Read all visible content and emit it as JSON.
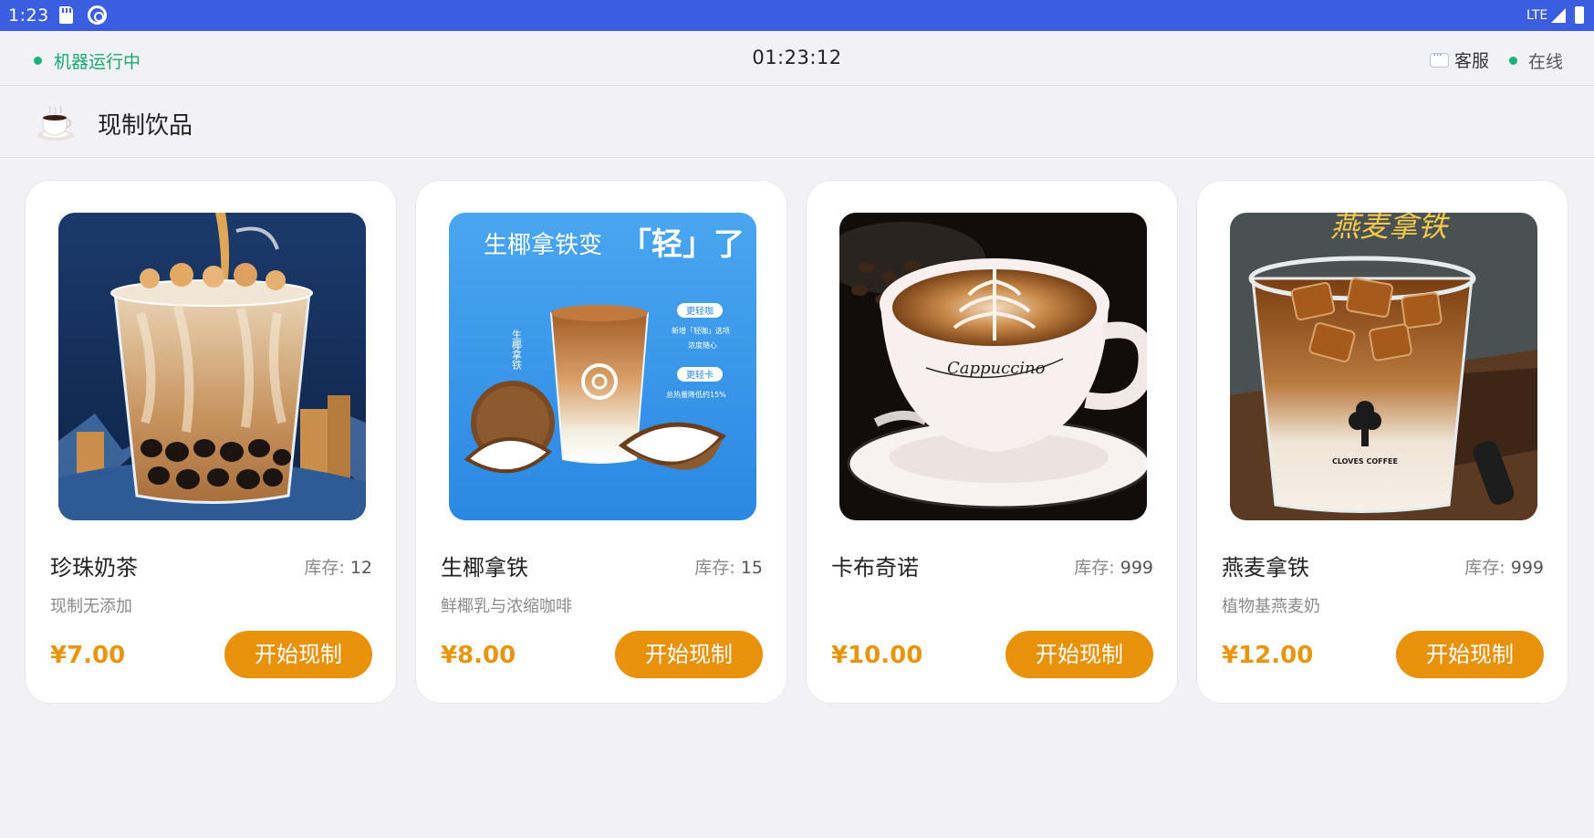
{
  "status_bar": {
    "time": "1:23",
    "network": "LTE"
  },
  "topbar": {
    "machine_status": "机器运行中",
    "clock": "01:23:12",
    "service_label": "客服",
    "online_label": "在线"
  },
  "category": {
    "title": "现制饮品"
  },
  "products": [
    {
      "name": "珍珠奶茶",
      "stock_label": "库存:",
      "stock": "12",
      "desc": "现制无添加",
      "price": "¥7.00",
      "button": "开始现制"
    },
    {
      "name": "生椰拿铁",
      "stock_label": "库存:",
      "stock": "15",
      "desc": "鲜椰乳与浓缩咖啡",
      "price": "¥8.00",
      "button": "开始现制",
      "image_text": {
        "headline_a": "生椰拿铁变",
        "headline_b": "「轻」了",
        "tag1": "更轻咖",
        "tag1_sub": "新增「轻咖」选项",
        "tag1_sub2": "浓度随心",
        "tag2": "更轻卡",
        "tag2_sub": "总热量降低约15%",
        "side": "生椰拿铁"
      }
    },
    {
      "name": "卡布奇诺",
      "stock_label": "库存:",
      "stock": "999",
      "desc": "",
      "price": "¥10.00",
      "button": "开始现制",
      "image_text": {
        "cup_script": "Cappuccino"
      }
    },
    {
      "name": "燕麦拿铁",
      "stock_label": "库存:",
      "stock": "999",
      "desc": "植物基燕麦奶",
      "price": "¥12.00",
      "button": "开始现制",
      "image_text": {
        "calligraphy": "燕麦拿铁",
        "brand": "CLOVES COFFEE"
      }
    }
  ],
  "colors": {
    "status_bar": "#3b5ee0",
    "running_green": "#18a870",
    "price_orange": "#e8950f",
    "button_orange": "#e8920c"
  }
}
